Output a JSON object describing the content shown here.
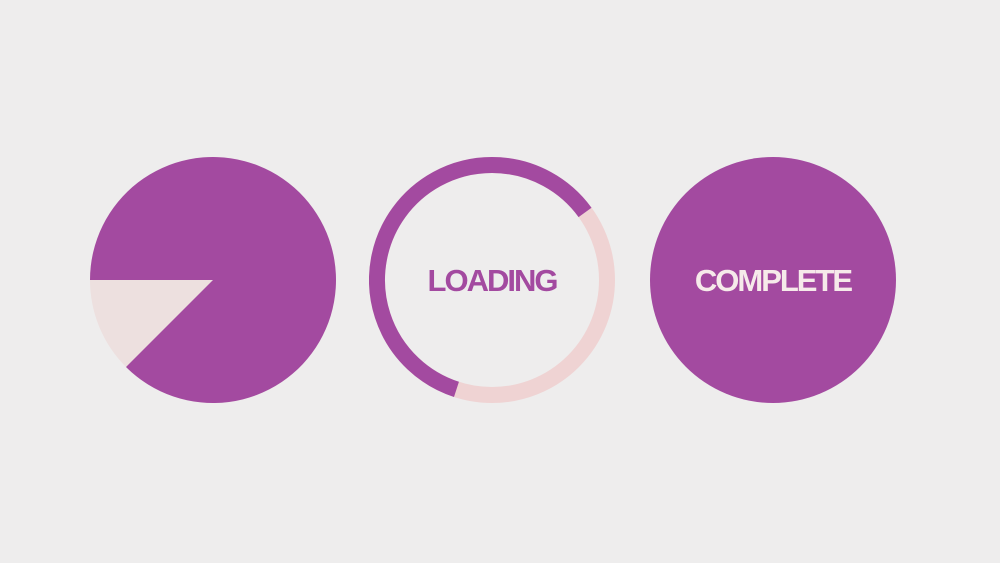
{
  "colors": {
    "background": "#eeeded",
    "accent": "#a34aa0",
    "pie_remaining": "#ede0df",
    "ring_remaining": "#efd3d3",
    "complete_text": "#f6eaea"
  },
  "pie_loader": {
    "progress": 0.875
  },
  "ring_loader": {
    "label": "LOADING",
    "progress": 0.6
  },
  "complete_badge": {
    "label": "COMPLETE"
  }
}
